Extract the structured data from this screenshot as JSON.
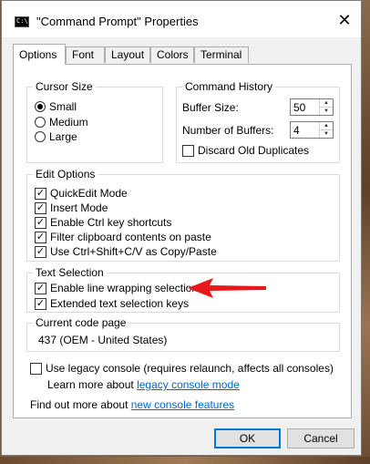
{
  "window": {
    "title": "\"Command Prompt\" Properties",
    "icon_text": "C:\\",
    "close_glyph": "✕"
  },
  "tabs": [
    {
      "label": "Options",
      "active": true
    },
    {
      "label": "Font",
      "active": false
    },
    {
      "label": "Layout",
      "active": false
    },
    {
      "label": "Colors",
      "active": false
    },
    {
      "label": "Terminal",
      "active": false
    }
  ],
  "cursor_size": {
    "legend": "Cursor Size",
    "options": [
      {
        "label": "Small",
        "selected": true
      },
      {
        "label": "Medium",
        "selected": false
      },
      {
        "label": "Large",
        "selected": false
      }
    ]
  },
  "command_history": {
    "legend": "Command History",
    "buffer_size_label": "Buffer Size:",
    "buffer_size_value": "50",
    "num_buffers_label": "Number of Buffers:",
    "num_buffers_value": "4",
    "discard_label": "Discard Old Duplicates",
    "discard_checked": false
  },
  "edit_options": {
    "legend": "Edit Options",
    "items": [
      {
        "label": "QuickEdit Mode",
        "checked": true
      },
      {
        "label": "Insert Mode",
        "checked": true
      },
      {
        "label": "Enable Ctrl key shortcuts",
        "checked": true
      },
      {
        "label": "Filter clipboard contents on paste",
        "checked": true
      },
      {
        "label": "Use Ctrl+Shift+C/V as Copy/Paste",
        "checked": true
      }
    ]
  },
  "text_selection": {
    "legend": "Text Selection",
    "items": [
      {
        "label": "Enable line wrapping selection",
        "checked": true
      },
      {
        "label": "Extended text selection keys",
        "checked": true
      }
    ]
  },
  "code_page": {
    "legend": "Current code page",
    "value": "437  (OEM - United States)"
  },
  "legacy": {
    "label": "Use legacy console (requires relaunch, affects all consoles)",
    "checked": false,
    "learn_prefix": "Learn more about ",
    "learn_link": "legacy console mode"
  },
  "footer": {
    "find_prefix": "Find out more about ",
    "find_link": "new console features"
  },
  "buttons": {
    "ok": "OK",
    "cancel": "Cancel"
  },
  "colors": {
    "accent": "#0078d7",
    "link": "#0066cc",
    "annotation_arrow": "#e8171b"
  },
  "icons": {
    "checkmark": "✓",
    "spin_up": "▲",
    "spin_down": "▼"
  }
}
